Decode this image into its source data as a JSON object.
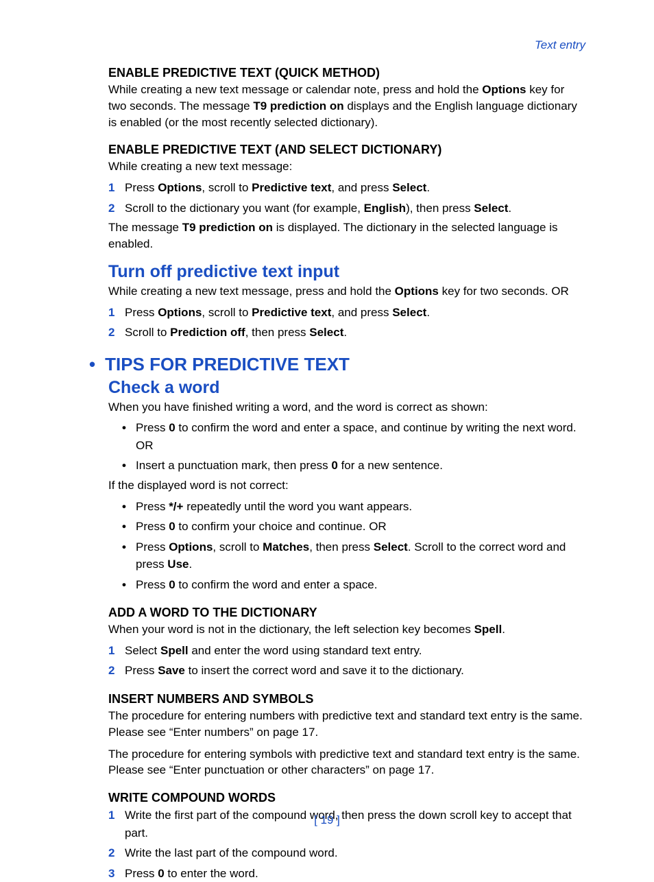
{
  "chapter": "Text entry",
  "page_number": "[ 19 ]",
  "s1": {
    "title": "ENABLE PREDICTIVE TEXT (QUICK METHOD)",
    "p1a": "While creating a new text message or calendar note, press and hold the ",
    "p1b": "Options",
    "p1c": " key for two seconds. The message ",
    "p1d": "T9 prediction on",
    "p1e": " displays and the English language dictionary is enabled (or the most recently selected dictionary)."
  },
  "s2": {
    "title": "ENABLE PREDICTIVE TEXT (AND SELECT DICTIONARY)",
    "intro": "While creating a new text message:",
    "step1": {
      "a": "Press ",
      "b": "Options",
      "c": ", scroll to ",
      "d": "Predictive text",
      "e": ", and press ",
      "f": "Select",
      "g": "."
    },
    "step2": {
      "a": "Scroll to the dictionary you want (for example, ",
      "b": "English",
      "c": "), then press ",
      "d": "Select",
      "e": "."
    },
    "after": {
      "a": "The message ",
      "b": "T9 prediction on",
      "c": " is displayed. The dictionary in the selected language is enabled."
    }
  },
  "s3": {
    "title": "Turn off predictive text input",
    "intro": {
      "a": "While creating a new text message, press and hold the ",
      "b": "Options",
      "c": " key for two seconds. OR"
    },
    "step1": {
      "a": "Press ",
      "b": "Options",
      "c": ", scroll to ",
      "d": "Predictive text",
      "e": ", and press ",
      "f": "Select",
      "g": "."
    },
    "step2": {
      "a": "Scroll to ",
      "b": "Prediction off",
      "c": ", then press ",
      "d": "Select",
      "e": "."
    }
  },
  "s4": {
    "main": "TIPS FOR PREDICTIVE TEXT",
    "sub": "Check a word",
    "intro": "When you have finished writing a word, and the word is correct as shown:",
    "b1": {
      "a": "Press ",
      "b": "0",
      "c": " to confirm the word and enter a space, and continue by writing the next word. OR"
    },
    "b2": {
      "a": "Insert a punctuation mark, then press ",
      "b": "0",
      "c": " for a new sentence."
    },
    "mid": "If the displayed word is not correct:",
    "b3": {
      "a": "Press ",
      "b": "*/+",
      "c": " repeatedly until the word you want appears."
    },
    "b4": {
      "a": "Press ",
      "b": "0",
      "c": " to confirm your choice and continue. OR"
    },
    "b5": {
      "a": "Press ",
      "b": "Options",
      "c": ", scroll to ",
      "d": "Matches",
      "e": ", then press ",
      "f": "Select",
      "g": ". Scroll to the correct word and press ",
      "h": "Use",
      "i": "."
    },
    "b6": {
      "a": "Press ",
      "b": "0",
      "c": " to confirm the word and enter a space."
    }
  },
  "s5": {
    "title": "ADD A WORD TO THE DICTIONARY",
    "intro": {
      "a": "When your word is not in the dictionary, the left selection key becomes ",
      "b": "Spell",
      "c": "."
    },
    "step1": {
      "a": "Select ",
      "b": "Spell",
      "c": " and enter the word using standard text entry."
    },
    "step2": {
      "a": "Press ",
      "b": "Save",
      "c": " to insert the correct word and save it to the dictionary."
    }
  },
  "s6": {
    "title": "INSERT NUMBERS AND SYMBOLS",
    "p1": "The procedure for entering numbers with predictive text and standard text entry is the same. Please see “Enter numbers” on page 17.",
    "p2": "The procedure for entering symbols with predictive text and standard text entry is the same. Please see “Enter punctuation or other characters” on page 17."
  },
  "s7": {
    "title": "WRITE COMPOUND WORDS",
    "step1": "Write the first part of the compound word, then press the down scroll key to accept that part.",
    "step2": "Write the last part of the compound word.",
    "step3": {
      "a": "Press ",
      "b": "0",
      "c": " to enter the word."
    }
  }
}
